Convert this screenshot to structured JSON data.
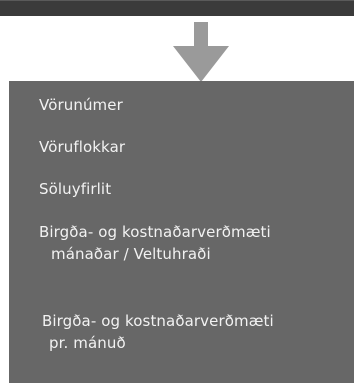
{
  "colors": {
    "top_bar": "#3b3b3b",
    "arrow": "#9a9a9a",
    "menu_background": "#676767",
    "menu_text": "#f2f2f2",
    "page_background": "#ffffff"
  },
  "icons": {
    "arrow": "down-arrow-icon"
  },
  "menu": {
    "items": [
      {
        "label": "Vörunúmer"
      },
      {
        "label": "Vöruflokkar"
      },
      {
        "label": "Söluyfirlit"
      },
      {
        "label_line1": "Birgða- og kostnaðarverðmæti",
        "label_line2": "mánaðar / Veltuhraði"
      },
      {
        "label_line1": "Birgða- og kostnaðarverðmæti",
        "label_line2": "pr. mánuð"
      }
    ]
  }
}
